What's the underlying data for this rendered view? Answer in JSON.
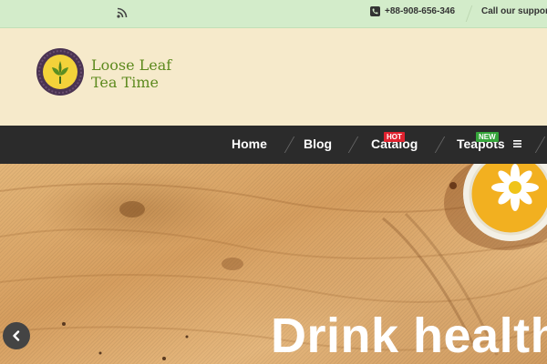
{
  "topbar": {
    "phone": "+88-908-656-346",
    "support": "Call our suppor"
  },
  "brand": {
    "line1": "Loose Leaf",
    "line2": "Tea Time"
  },
  "nav": {
    "items": [
      {
        "label": "Home"
      },
      {
        "label": "Blog"
      },
      {
        "label": "Catalog",
        "badge": "HOT"
      },
      {
        "label": "Teapots",
        "badge": "NEW"
      }
    ]
  },
  "hero": {
    "title": "Drink health"
  },
  "colors": {
    "topbar": "#d3ecca",
    "header": "#f6eacb",
    "nav": "#2b2b2b",
    "brand": "#5d8a1e",
    "hot": "#e0222f",
    "new": "#35a53a"
  },
  "icons": [
    "rss-icon",
    "phone-icon",
    "menu-icon",
    "chevron-left-icon"
  ]
}
